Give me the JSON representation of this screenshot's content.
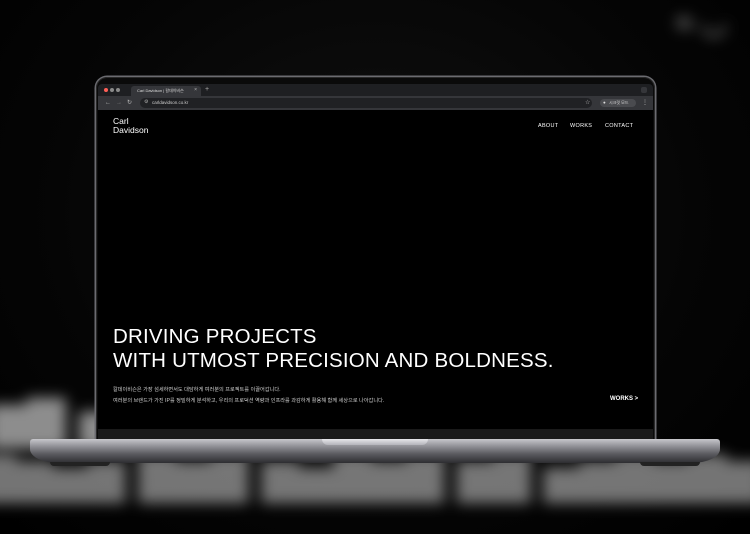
{
  "browser": {
    "tab_title": "Carl Davidson | 칼데이비슨",
    "new_tab": "+",
    "url": "carldavidson.co.kr",
    "profile_label": "시크릿 모드",
    "colors": {
      "chrome_dark": "#1e1f22",
      "toolbar": "#35363a"
    }
  },
  "site": {
    "logo_line1": "Carl",
    "logo_line2": "Davidson",
    "nav": [
      "ABOUT",
      "WORKS",
      "CONTACT"
    ],
    "headline_line1": "DRIVING PROJECTS",
    "headline_line2": "WITH UTMOST PRECISION AND BOLDNESS.",
    "desc_line1": "칼데이비슨은 가장 섬세하면서도 대담하게 여러분의 프로젝트를 이끌어갑니다.",
    "desc_line2": "여러분의 브랜드가 가진 IP를 정밀하게 분석하고, 우리의 프로덕션 역량과 인프라를 과감하게 활용해 함께 세상으로 나아갑니다.",
    "works_link": "WORKS >"
  }
}
